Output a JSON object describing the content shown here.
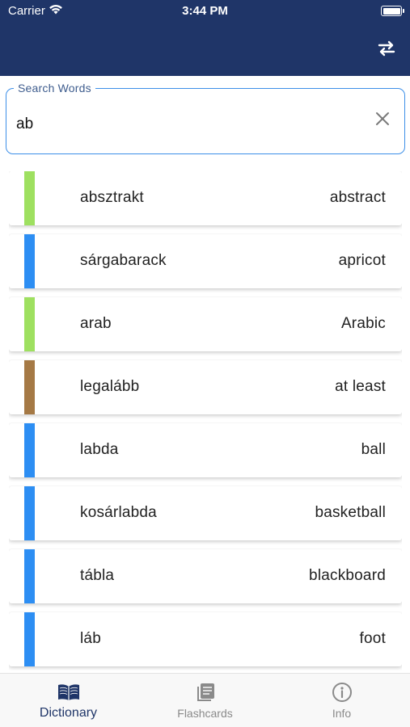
{
  "status_bar": {
    "carrier": "Carrier",
    "time": "3:44 PM",
    "icons": [
      "wifi-icon",
      "battery-icon"
    ]
  },
  "header": {
    "background": "#1f3568",
    "swap_icon": "swap-arrows-icon"
  },
  "search": {
    "label": "Search Words",
    "value": "ab",
    "clear_icon": "close-icon",
    "border_color": "#3d8fe8"
  },
  "words": [
    {
      "source": "absztrakt",
      "target": "abstract",
      "color": "#9ee060"
    },
    {
      "source": "sárgabarack",
      "target": "apricot",
      "color": "#2d8ef3"
    },
    {
      "source": "arab",
      "target": "Arabic",
      "color": "#9ee060"
    },
    {
      "source": "legalább",
      "target": "at least",
      "color": "#a57945"
    },
    {
      "source": "labda",
      "target": "ball",
      "color": "#2d8ef3"
    },
    {
      "source": "kosárlabda",
      "target": "basketball",
      "color": "#2d8ef3"
    },
    {
      "source": "tábla",
      "target": "blackboard",
      "color": "#2d8ef3"
    },
    {
      "source": "láb",
      "target": "foot",
      "color": "#2d8ef3"
    }
  ],
  "tabs": [
    {
      "label": "Dictionary",
      "icon": "open-book-icon",
      "active": true
    },
    {
      "label": "Flashcards",
      "icon": "flashcards-stack-icon",
      "active": false
    },
    {
      "label": "Info",
      "icon": "info-circle-icon",
      "active": false
    }
  ],
  "colors": {
    "active_tab": "#1f3568",
    "inactive_tab": "#8a8a8a"
  }
}
